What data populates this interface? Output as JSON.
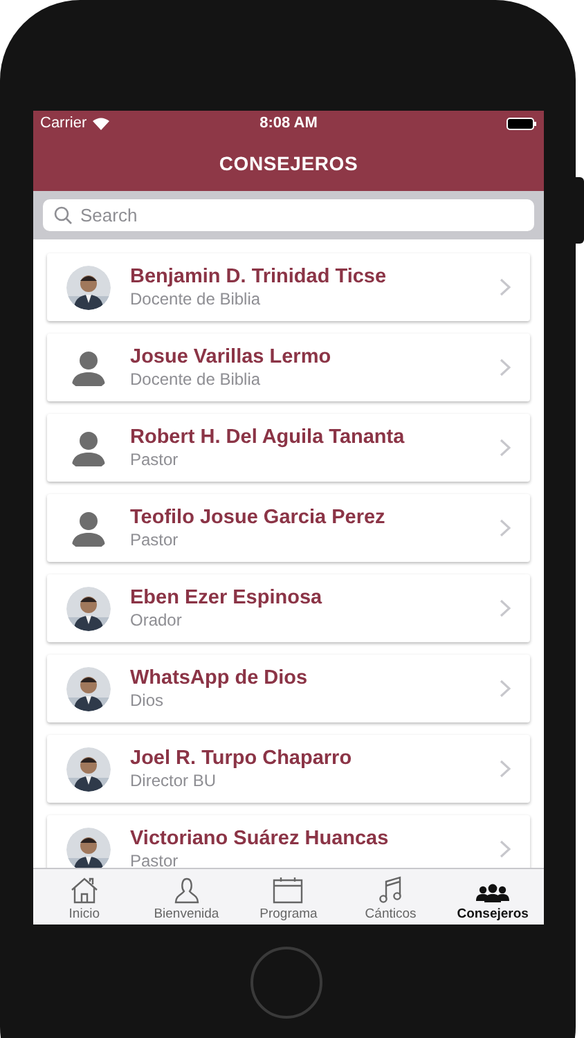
{
  "status_bar": {
    "carrier": "Carrier",
    "time": "8:08 AM"
  },
  "header": {
    "title": "CONSEJEROS"
  },
  "search": {
    "placeholder": "Search"
  },
  "counselors": [
    {
      "name": "Benjamin D. Trinidad Ticse",
      "role": "Docente de Biblia"
    },
    {
      "name": "Josue Varillas Lermo",
      "role": "Docente de Biblia",
      "kind": "placeholder"
    },
    {
      "name": "Robert H. Del Aguila Tananta",
      "role": "Pastor",
      "kind": "placeholder"
    },
    {
      "name": "Teofilo Josue Garcia Perez",
      "role": "Pastor",
      "kind": "placeholder"
    },
    {
      "name": "Eben Ezer Espinosa",
      "role": "Orador"
    },
    {
      "name": "WhatsApp de Dios",
      "role": "Dios"
    },
    {
      "name": "Joel R. Turpo Chaparro",
      "role": "Director BU"
    },
    {
      "name": "Victoriano Suárez Huancas",
      "role": "Pastor"
    }
  ],
  "tab_bar": [
    {
      "label": "Inicio",
      "selected": false
    },
    {
      "label": "Bienvenida",
      "selected": false
    },
    {
      "label": "Programa",
      "selected": false
    },
    {
      "label": "Cánticos",
      "selected": false
    },
    {
      "label": "Consejeros",
      "selected": true
    }
  ]
}
